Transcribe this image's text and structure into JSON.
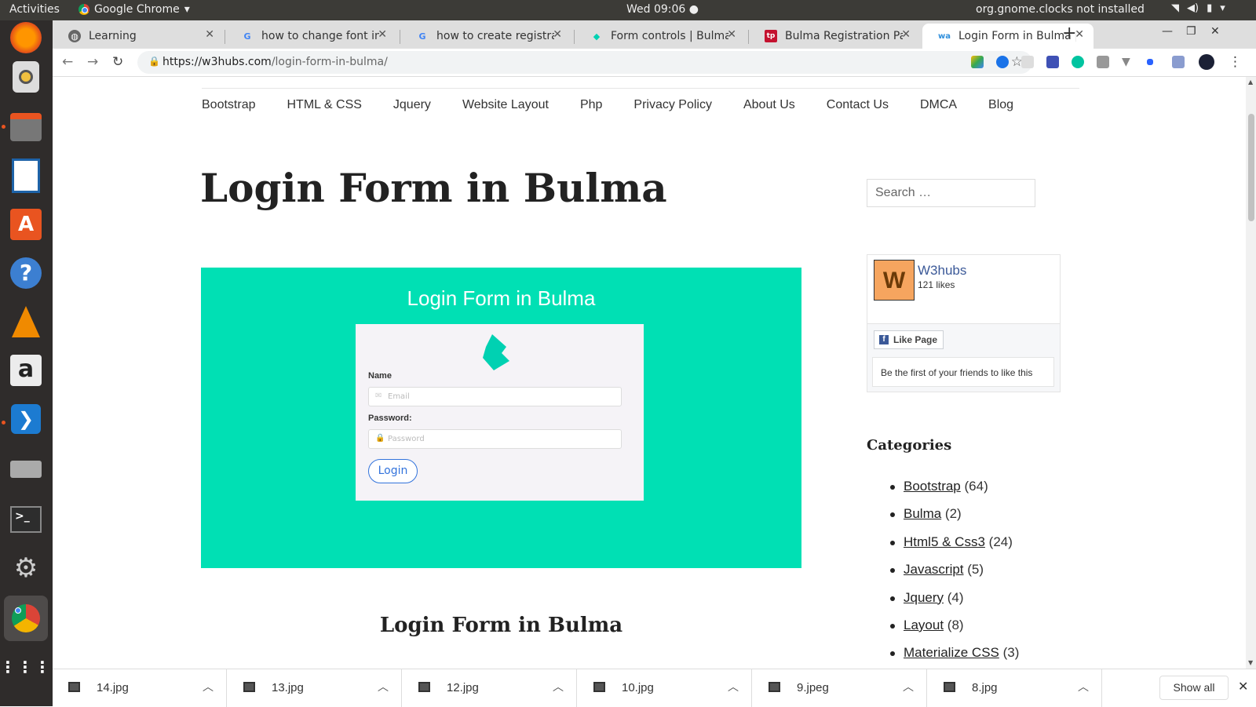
{
  "system": {
    "activities": "Activities",
    "app_menu": "Google Chrome",
    "clock": "Wed 09:06 ●",
    "notice": "org.gnome.clocks not installed"
  },
  "tabs": [
    {
      "title": "Learning",
      "favicon": "globe-icon"
    },
    {
      "title": "how to change font in b",
      "favicon": "google-icon"
    },
    {
      "title": "how to create registrat",
      "favicon": "google-icon"
    },
    {
      "title": "Form controls | Bulma:",
      "favicon": "bulma-icon"
    },
    {
      "title": "Bulma Registration Pag",
      "favicon": "tp-icon"
    },
    {
      "title": "Login Form in Bulma | W",
      "favicon": "w3hubs-icon",
      "active": true
    }
  ],
  "address": {
    "host": "https://w3hubs.com",
    "path": "/login-form-in-bulma/"
  },
  "nav": [
    "Bootstrap",
    "HTML & CSS",
    "Jquery",
    "Website Layout",
    "Php",
    "Privacy Policy",
    "About Us",
    "Contact Us",
    "DMCA",
    "Blog"
  ],
  "post": {
    "title": "Login Form in Bulma",
    "subtitle": "Login Form in Bulma"
  },
  "hero": {
    "title": "Login Form in Bulma",
    "name_label": "Name",
    "email_placeholder": "Email",
    "password_label": "Password:",
    "password_placeholder": "Password",
    "login_button": "Login",
    "background": "#00e0b4"
  },
  "sidebar": {
    "search_placeholder": "Search …",
    "fb": {
      "logo_letter": "W",
      "page_name": "W3hubs",
      "likes": "121 likes",
      "like_button": "Like Page",
      "friends_text": "Be the first of your friends to like this"
    },
    "categories_title": "Categories",
    "categories": [
      {
        "name": "Bootstrap",
        "count": "(64)"
      },
      {
        "name": "Bulma",
        "count": "(2)"
      },
      {
        "name": "Html5 & Css3",
        "count": "(24)"
      },
      {
        "name": "Javascript",
        "count": "(5)"
      },
      {
        "name": "Jquery",
        "count": "(4)"
      },
      {
        "name": "Layout",
        "count": "(8)"
      },
      {
        "name": "Materialize CSS",
        "count": "(3)"
      }
    ]
  },
  "downloads": [
    {
      "name": "14.jpg"
    },
    {
      "name": "13.jpg"
    },
    {
      "name": "12.jpg"
    },
    {
      "name": "10.jpg"
    },
    {
      "name": "9.jpeg"
    },
    {
      "name": "8.jpg"
    }
  ],
  "show_all": "Show all"
}
